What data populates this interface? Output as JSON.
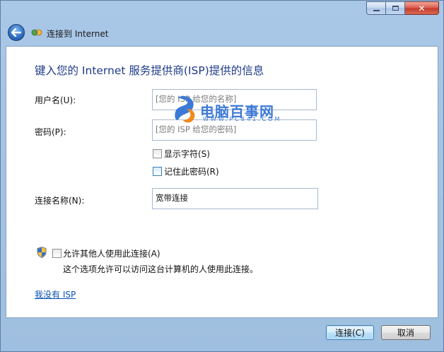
{
  "window": {
    "title": "连接到 Internet",
    "caption_buttons": [
      "minimize",
      "maximize",
      "close"
    ]
  },
  "form": {
    "heading": "键入您的 Internet 服务提供商(ISP)提供的信息",
    "username_label": "用户名(U):",
    "username_placeholder": "[您的 ISP 给您的名称]",
    "password_label": "密码(P):",
    "password_placeholder": "[您的 ISP 给您的密码]",
    "show_chars_label": "显示字符(S)",
    "show_chars_checked": false,
    "remember_password_label": "记住此密码(R)",
    "remember_password_checked": false,
    "connection_name_label": "连接名称(N):",
    "connection_name_value": "宽带连接",
    "allow_others_label": "允许其他人使用此连接(A)",
    "allow_others_checked": false,
    "allow_others_description": "这个选项允许可以访问这台计算机的人使用此连接。",
    "no_isp_link": "我没有 ISP"
  },
  "watermark": {
    "text": "电脑百事网",
    "sub": "WWW.PC841.COM"
  },
  "buttons": {
    "connect": "连接(C)",
    "cancel": "取消"
  },
  "colors": {
    "heading": "#1f3b8a",
    "link": "#0a4fb5",
    "watermark": "#3d79d6"
  }
}
